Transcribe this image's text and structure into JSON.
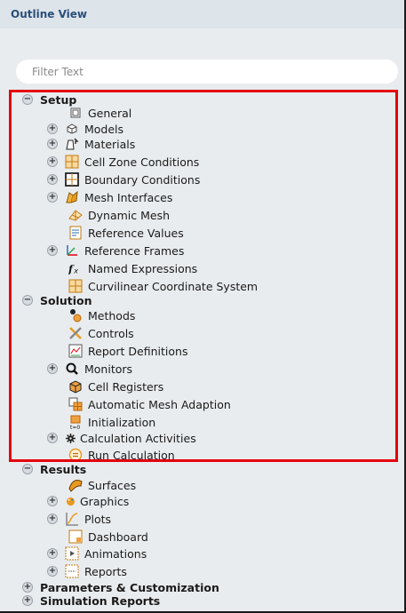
{
  "panel": {
    "title": "Outline View",
    "filter_placeholder": "Filter Text"
  },
  "tree": {
    "setup": {
      "label": "Setup",
      "items": [
        {
          "label": "General"
        },
        {
          "label": "Models"
        },
        {
          "label": "Materials"
        },
        {
          "label": "Cell Zone Conditions"
        },
        {
          "label": "Boundary Conditions"
        },
        {
          "label": "Mesh Interfaces"
        },
        {
          "label": "Dynamic Mesh"
        },
        {
          "label": "Reference Values"
        },
        {
          "label": "Reference Frames"
        },
        {
          "label": "Named Expressions"
        },
        {
          "label": "Curvilinear Coordinate System"
        }
      ]
    },
    "solution": {
      "label": "Solution",
      "items": [
        {
          "label": "Methods"
        },
        {
          "label": "Controls"
        },
        {
          "label": "Report Definitions"
        },
        {
          "label": "Monitors"
        },
        {
          "label": "Cell Registers"
        },
        {
          "label": "Automatic Mesh Adaption"
        },
        {
          "label": "Initialization"
        },
        {
          "label": "Calculation Activities"
        },
        {
          "label": "Run Calculation"
        }
      ]
    },
    "results": {
      "label": "Results",
      "items": [
        {
          "label": "Surfaces"
        },
        {
          "label": "Graphics"
        },
        {
          "label": "Plots"
        },
        {
          "label": "Dashboard"
        },
        {
          "label": "Animations"
        },
        {
          "label": "Reports"
        }
      ]
    },
    "parameters": {
      "label": "Parameters & Customization"
    },
    "simulation_reports": {
      "label": "Simulation Reports"
    }
  },
  "expander": {
    "collapse": "−",
    "expand": "+"
  },
  "colors": {
    "highlight": "#e3000f",
    "title": "#2a4f7a",
    "background": "#e9ecef"
  }
}
